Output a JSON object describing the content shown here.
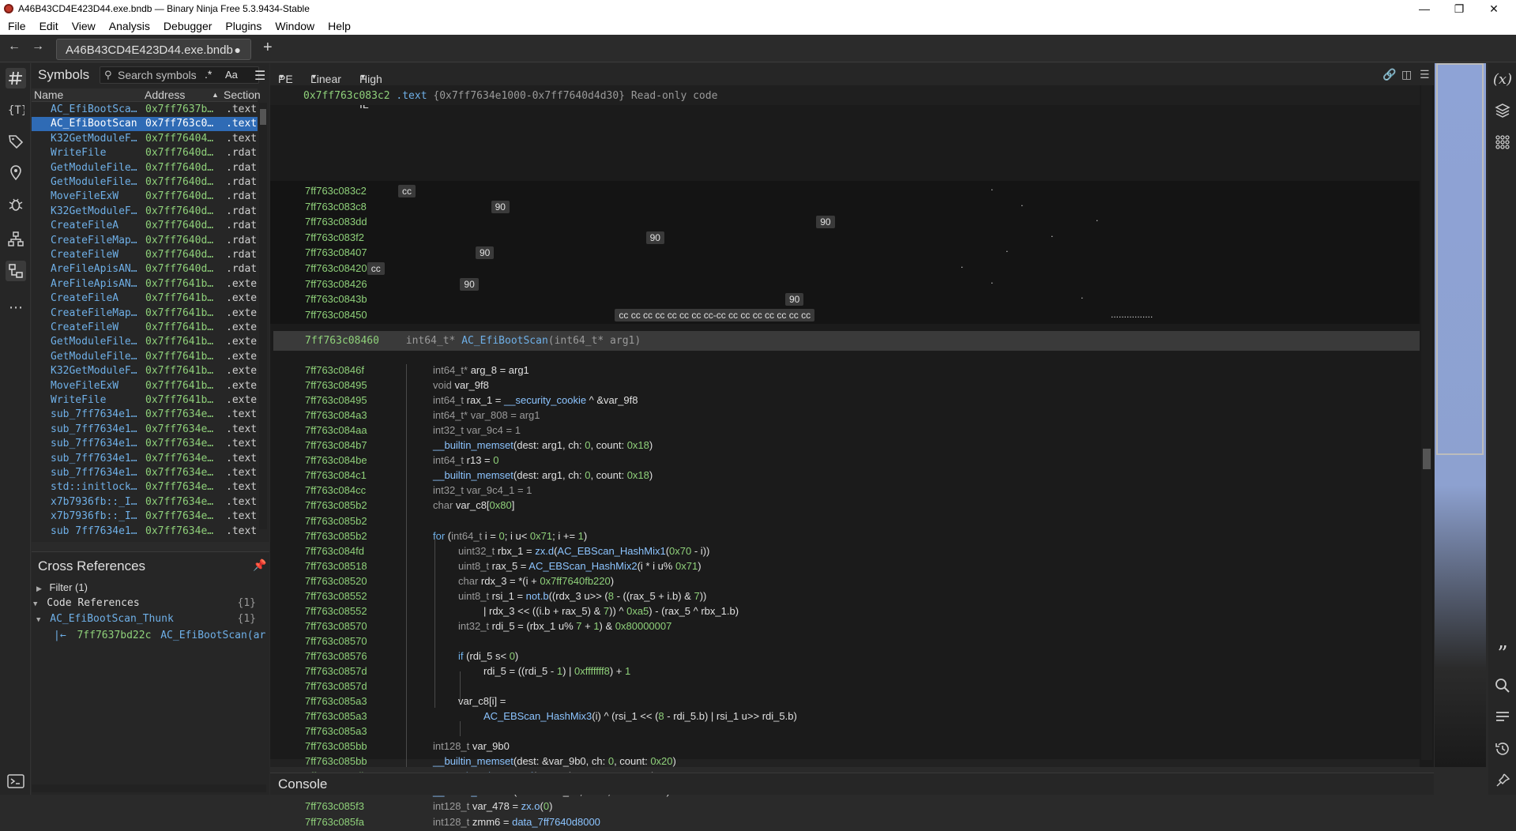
{
  "window": {
    "title": "A46B43CD4E423D44.exe.bndb — Binary Ninja Free 5.3.9434-Stable"
  },
  "menu": [
    "File",
    "Edit",
    "View",
    "Analysis",
    "Debugger",
    "Plugins",
    "Window",
    "Help"
  ],
  "tab": {
    "label": "A46B43CD4E423D44.exe.bndb",
    "modified_dot": "●"
  },
  "symbols": {
    "title": "Symbols",
    "search_placeholder": "Search symbols",
    "columns": {
      "name": "Name",
      "address": "Address",
      "section": "Section"
    },
    "rows": [
      {
        "name": "AC_EfiBootSca…",
        "address": "0x7ff7637b…",
        "section": ".text"
      },
      {
        "name": "AC_EfiBootScan",
        "address": "0x7ff763c0…",
        "section": ".text"
      },
      {
        "name": "K32GetModuleF…",
        "address": "0x7ff76404…",
        "section": ".text"
      },
      {
        "name": "WriteFile",
        "address": "0x7ff7640d…",
        "section": ".rdat"
      },
      {
        "name": "GetModuleFile…",
        "address": "0x7ff7640d…",
        "section": ".rdat"
      },
      {
        "name": "GetModuleFile…",
        "address": "0x7ff7640d…",
        "section": ".rdat"
      },
      {
        "name": "MoveFileExW",
        "address": "0x7ff7640d…",
        "section": ".rdat"
      },
      {
        "name": "K32GetModuleF…",
        "address": "0x7ff7640d…",
        "section": ".rdat"
      },
      {
        "name": "CreateFileA",
        "address": "0x7ff7640d…",
        "section": ".rdat"
      },
      {
        "name": "CreateFileMap…",
        "address": "0x7ff7640d…",
        "section": ".rdat"
      },
      {
        "name": "CreateFileW",
        "address": "0x7ff7640d…",
        "section": ".rdat"
      },
      {
        "name": "AreFileApisAN…",
        "address": "0x7ff7640d…",
        "section": ".rdat"
      },
      {
        "name": "AreFileApisAN…",
        "address": "0x7ff7641b…",
        "section": ".exte"
      },
      {
        "name": "CreateFileA",
        "address": "0x7ff7641b…",
        "section": ".exte"
      },
      {
        "name": "CreateFileMap…",
        "address": "0x7ff7641b…",
        "section": ".exte"
      },
      {
        "name": "CreateFileW",
        "address": "0x7ff7641b…",
        "section": ".exte"
      },
      {
        "name": "GetModuleFile…",
        "address": "0x7ff7641b…",
        "section": ".exte"
      },
      {
        "name": "GetModuleFile…",
        "address": "0x7ff7641b…",
        "section": ".exte"
      },
      {
        "name": "K32GetModuleF…",
        "address": "0x7ff7641b…",
        "section": ".exte"
      },
      {
        "name": "MoveFileExW",
        "address": "0x7ff7641b…",
        "section": ".exte"
      },
      {
        "name": "WriteFile",
        "address": "0x7ff7641b…",
        "section": ".exte"
      },
      {
        "name": "sub_7ff7634e1…",
        "address": "0x7ff7634e…",
        "section": ".text"
      },
      {
        "name": "sub_7ff7634e1…",
        "address": "0x7ff7634e…",
        "section": ".text"
      },
      {
        "name": "sub_7ff7634e1…",
        "address": "0x7ff7634e…",
        "section": ".text"
      },
      {
        "name": "sub_7ff7634e1…",
        "address": "0x7ff7634e…",
        "section": ".text"
      },
      {
        "name": "sub_7ff7634e1…",
        "address": "0x7ff7634e…",
        "section": ".text"
      },
      {
        "name": "std::initlock…",
        "address": "0x7ff7634e…",
        "section": ".text"
      },
      {
        "name": "x7b7936fb::_I…",
        "address": "0x7ff7634e…",
        "section": ".text"
      },
      {
        "name": "x7b7936fb::_I…",
        "address": "0x7ff7634e…",
        "section": ".text"
      },
      {
        "name": "sub_7ff7634e1…",
        "address": "0x7ff7634e…",
        "section": ".text"
      },
      {
        "name": "sub_7ff7634e1…",
        "address": "0x7ff7634e…",
        "section": ".text"
      }
    ],
    "selected_index": 1
  },
  "xrefs": {
    "title": "Cross References",
    "filter": "Filter (1)",
    "code_refs": "Code References",
    "code_refs_count": "{1}",
    "func": "AC_EfiBootScan_Thunk",
    "func_count": "{1}",
    "ref_addr": "7ff7637bd22c",
    "ref_text": "AC_EfiBootScan(ar"
  },
  "view": {
    "platform": "PE",
    "layout": "Linear",
    "il": "High Level IL",
    "section_addr": "0x7ff763c083c2",
    "section_name": ".text",
    "section_range": "{0x7ff7634e1000-0x7ff7640d4d30}",
    "section_desc": "Read-only code"
  },
  "hex_rows": [
    {
      "addr": "7ff763c083c2",
      "bytes": [
        {
          "t": "cc",
          "col": 0
        }
      ],
      "dot": 48
    },
    {
      "addr": "7ff763c083c8",
      "bytes": [
        {
          "t": "90",
          "col": 6
        }
      ],
      "dot": 50
    },
    {
      "addr": "7ff763c083dd",
      "bytes": [
        {
          "t": "90",
          "col": 27
        }
      ],
      "dot": 55
    },
    {
      "addr": "7ff763c083f2",
      "bytes": [
        {
          "t": "90",
          "col": 16
        }
      ],
      "dot": 52
    },
    {
      "addr": "7ff763c08407",
      "bytes": [
        {
          "t": "90",
          "col": 5
        }
      ],
      "dot": 49
    },
    {
      "addr": "7ff763c08420",
      "bytes": [
        {
          "t": "cc",
          "col": -2
        }
      ],
      "dot": 46
    },
    {
      "addr": "7ff763c08426",
      "bytes": [
        {
          "t": "90",
          "col": 4
        }
      ],
      "dot": 48
    },
    {
      "addr": "7ff763c0843b",
      "bytes": [
        {
          "t": "90",
          "col": 25
        }
      ],
      "dot": 54
    },
    {
      "addr": "7ff763c08450",
      "bytes": [
        {
          "t": "cc cc cc cc cc cc cc cc-cc cc cc cc cc cc cc cc",
          "col": 14
        }
      ],
      "dots": "................"
    }
  ],
  "signature": {
    "addr": "7ff763c08460",
    "ret": "int64_t*",
    "name": "AC_EfiBootScan",
    "params": "(int64_t* arg1)"
  },
  "code": [
    {
      "addr": "7ff763c0846f",
      "ind": 0,
      "parts": [
        [
          "ty",
          "int64_t* "
        ],
        [
          "va",
          "arg_8 = arg1"
        ]
      ]
    },
    {
      "addr": "7ff763c08495",
      "ind": 0,
      "parts": [
        [
          "ty",
          "void "
        ],
        [
          "va",
          "var_9f8"
        ]
      ]
    },
    {
      "addr": "7ff763c08495",
      "ind": 0,
      "parts": [
        [
          "ty",
          "int64_t "
        ],
        [
          "va",
          "rax_1 = "
        ],
        [
          "fn",
          "__security_cookie"
        ],
        [
          "va",
          " ^ &var_9f8"
        ]
      ]
    },
    {
      "addr": "7ff763c084a3",
      "ind": 0,
      "parts": [
        [
          "ty",
          "int64_t* var_808 = arg1"
        ]
      ]
    },
    {
      "addr": "7ff763c084aa",
      "ind": 0,
      "parts": [
        [
          "ty",
          "int32_t var_9c4 = 1"
        ]
      ]
    },
    {
      "addr": "7ff763c084b7",
      "ind": 0,
      "parts": [
        [
          "fn",
          "__builtin_memset"
        ],
        [
          "va",
          "(dest: arg1, ch: "
        ],
        [
          "nm",
          "0"
        ],
        [
          "va",
          ", count: "
        ],
        [
          "nm",
          "0x18"
        ],
        [
          "va",
          ")"
        ]
      ]
    },
    {
      "addr": "7ff763c084be",
      "ind": 0,
      "parts": [
        [
          "ty",
          "int64_t "
        ],
        [
          "va",
          "r13 = "
        ],
        [
          "nm",
          "0"
        ]
      ]
    },
    {
      "addr": "7ff763c084c1",
      "ind": 0,
      "parts": [
        [
          "fn",
          "__builtin_memset"
        ],
        [
          "va",
          "(dest: arg1, ch: "
        ],
        [
          "nm",
          "0"
        ],
        [
          "va",
          ", count: "
        ],
        [
          "nm",
          "0x18"
        ],
        [
          "va",
          ")"
        ]
      ]
    },
    {
      "addr": "7ff763c084cc",
      "ind": 0,
      "parts": [
        [
          "ty",
          "int32_t var_9c4_1 = 1"
        ]
      ]
    },
    {
      "addr": "7ff763c085b2",
      "ind": 0,
      "parts": [
        [
          "ty",
          "char "
        ],
        [
          "va",
          "var_c8["
        ],
        [
          "nm",
          "0x80"
        ],
        [
          "va",
          "]"
        ]
      ]
    },
    {
      "addr": "7ff763c085b2",
      "ind": 0,
      "parts": []
    },
    {
      "addr": "7ff763c085b2",
      "ind": 0,
      "parts": [
        [
          "kw",
          "for "
        ],
        [
          "va",
          "("
        ],
        [
          "ty",
          "int64_t "
        ],
        [
          "va",
          "i = "
        ],
        [
          "nm",
          "0"
        ],
        [
          "va",
          "; i u< "
        ],
        [
          "nm",
          "0x71"
        ],
        [
          "va",
          "; i += "
        ],
        [
          "nm",
          "1"
        ],
        [
          "va",
          ")"
        ]
      ]
    },
    {
      "addr": "7ff763c084fd",
      "ind": 1,
      "parts": [
        [
          "ty",
          "uint32_t "
        ],
        [
          "va",
          "rbx_1 = "
        ],
        [
          "fn",
          "zx.d"
        ],
        [
          "va",
          "("
        ],
        [
          "fn",
          "AC_EBScan_HashMix1"
        ],
        [
          "va",
          "("
        ],
        [
          "nm",
          "0x70"
        ],
        [
          "va",
          " - i))"
        ]
      ]
    },
    {
      "addr": "7ff763c08518",
      "ind": 1,
      "parts": [
        [
          "ty",
          "uint8_t "
        ],
        [
          "va",
          "rax_5 = "
        ],
        [
          "fn",
          "AC_EBScan_HashMix2"
        ],
        [
          "va",
          "(i * i u% "
        ],
        [
          "nm",
          "0x71"
        ],
        [
          "va",
          ")"
        ]
      ]
    },
    {
      "addr": "7ff763c08520",
      "ind": 1,
      "parts": [
        [
          "ty",
          "char "
        ],
        [
          "va",
          "rdx_3 = *(i + "
        ],
        [
          "nm",
          "0x7ff7640fb220"
        ],
        [
          "va",
          ")"
        ]
      ]
    },
    {
      "addr": "7ff763c08552",
      "ind": 1,
      "parts": [
        [
          "ty",
          "uint8_t "
        ],
        [
          "va",
          "rsi_1 = "
        ],
        [
          "fn",
          "not.b"
        ],
        [
          "va",
          "((rdx_3 u>> ("
        ],
        [
          "nm",
          "8"
        ],
        [
          "va",
          " - ((rax_5 + i.b) & "
        ],
        [
          "nm",
          "7"
        ],
        [
          "va",
          "))"
        ]
      ]
    },
    {
      "addr": "7ff763c08552",
      "ind": 2,
      "parts": [
        [
          "va",
          "| rdx_3 << ((i.b + rax_5) & "
        ],
        [
          "nm",
          "7"
        ],
        [
          "va",
          ")) ^ "
        ],
        [
          "nm",
          "0xa5"
        ],
        [
          "va",
          ") - (rax_5 ^ rbx_1.b)"
        ]
      ]
    },
    {
      "addr": "7ff763c08570",
      "ind": 1,
      "parts": [
        [
          "ty",
          "int32_t "
        ],
        [
          "va",
          "rdi_5 = (rbx_1 u% "
        ],
        [
          "nm",
          "7"
        ],
        [
          "va",
          " + "
        ],
        [
          "nm",
          "1"
        ],
        [
          "va",
          ") & "
        ],
        [
          "nm",
          "0x80000007"
        ]
      ]
    },
    {
      "addr": "7ff763c08570",
      "ind": 1,
      "parts": []
    },
    {
      "addr": "7ff763c08576",
      "ind": 1,
      "parts": [
        [
          "kw",
          "if "
        ],
        [
          "va",
          "(rdi_5 s< "
        ],
        [
          "nm",
          "0"
        ],
        [
          "va",
          ")"
        ]
      ]
    },
    {
      "addr": "7ff763c0857d",
      "ind": 2,
      "parts": [
        [
          "va",
          "rdi_5 = ((rdi_5 - "
        ],
        [
          "nm",
          "1"
        ],
        [
          "va",
          ") | "
        ],
        [
          "nm",
          "0xfffffff8"
        ],
        [
          "va",
          ") + "
        ],
        [
          "nm",
          "1"
        ]
      ]
    },
    {
      "addr": "7ff763c0857d",
      "ind": 1,
      "parts": []
    },
    {
      "addr": "7ff763c085a3",
      "ind": 1,
      "parts": [
        [
          "va",
          "var_c8[i] ="
        ]
      ]
    },
    {
      "addr": "7ff763c085a3",
      "ind": 2,
      "parts": [
        [
          "fn",
          "AC_EBScan_HashMix3"
        ],
        [
          "va",
          "(i) ^ (rsi_1 << ("
        ],
        [
          "nm",
          "8"
        ],
        [
          "va",
          " - rdi_5.b) | rsi_1 u>> rdi_5.b)"
        ]
      ]
    },
    {
      "addr": "7ff763c085a3",
      "ind": 0,
      "parts": []
    },
    {
      "addr": "7ff763c085bb",
      "ind": 0,
      "parts": [
        [
          "ty",
          "int128_t "
        ],
        [
          "va",
          "var_9b0"
        ]
      ]
    },
    {
      "addr": "7ff763c085bb",
      "ind": 0,
      "parts": [
        [
          "fn",
          "__builtin_memset"
        ],
        [
          "va",
          "(dest: &var_9b0, ch: "
        ],
        [
          "nm",
          "0"
        ],
        [
          "va",
          ", count: "
        ],
        [
          "nm",
          "0x20"
        ],
        [
          "va",
          ")"
        ]
      ]
    },
    {
      "addr": "7ff763c085db",
      "ind": 0,
      "parts": [
        [
          "fn",
          "AC_StringInitFromBuf"
        ],
        [
          "va",
          "(&var_9b0, &var_c8, "
        ],
        [
          "nm",
          "0x70"
        ],
        [
          "va",
          ")"
        ]
      ]
    },
    {
      "addr": "7ff763c085ee",
      "ind": 0,
      "parts": [
        [
          "fn",
          "__builtin_memset"
        ],
        [
          "va",
          "(dest: &var_c8, ch: "
        ],
        [
          "nm",
          "0"
        ],
        [
          "va",
          ", count: "
        ],
        [
          "nm",
          "0x71"
        ],
        [
          "va",
          ")"
        ]
      ]
    },
    {
      "addr": "7ff763c085f3",
      "ind": 0,
      "parts": [
        [
          "ty",
          "int128_t "
        ],
        [
          "va",
          "var_478 = "
        ],
        [
          "fn",
          "zx.o"
        ],
        [
          "va",
          "("
        ],
        [
          "nm",
          "0"
        ],
        [
          "va",
          ")"
        ]
      ]
    },
    {
      "addr": "7ff763c085fa",
      "ind": 0,
      "parts": [
        [
          "ty",
          "int128_t "
        ],
        [
          "va",
          "zmm6 = "
        ],
        [
          "fn",
          "data_7ff7640d8000"
        ]
      ]
    }
  ],
  "console": {
    "label": "Console"
  },
  "colors": {
    "address": "#8fd17a",
    "symbol": "#6fb0e8",
    "selection": "#2f6bb5",
    "minimap": "#8ea3d6"
  }
}
